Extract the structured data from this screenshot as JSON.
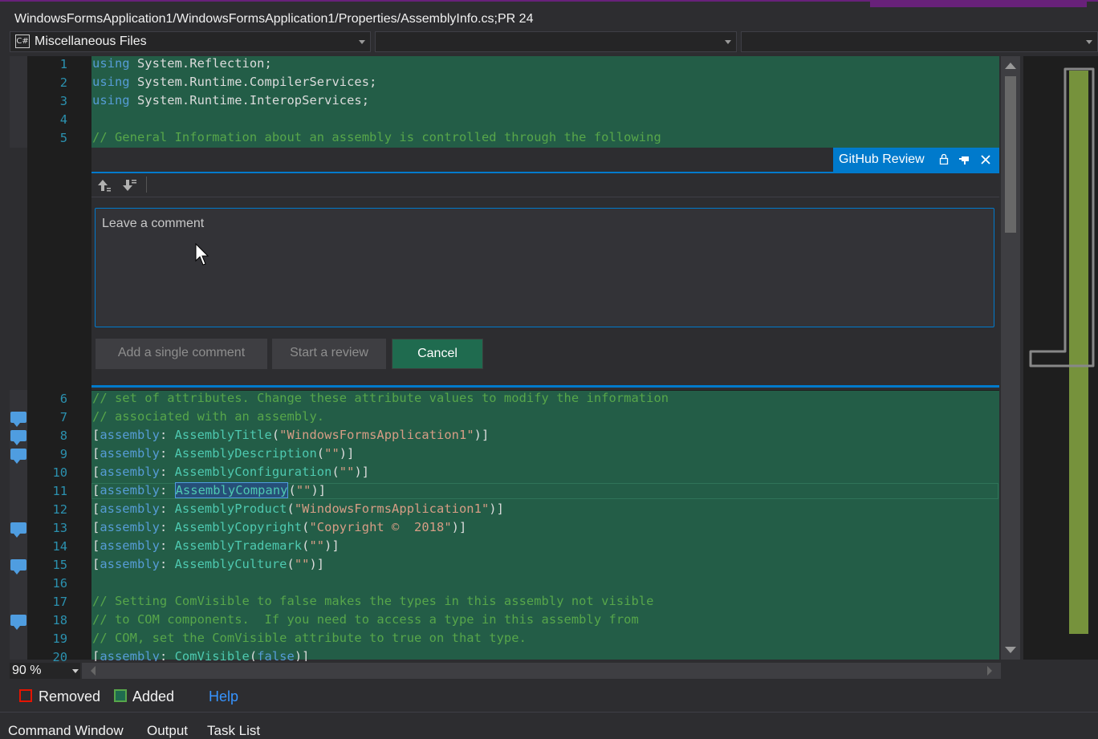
{
  "window": {
    "title": "WindowsFormsApplication1/WindowsFormsApplication1/Properties/AssemblyInfo.cs;PR 24",
    "accent_color": "#68217a"
  },
  "navbar": {
    "project_icon": "csharp-file-icon",
    "project_combo": "Miscellaneous Files",
    "type_combo": "",
    "member_combo": ""
  },
  "code_top": [
    {
      "n": "1",
      "tokens": [
        [
          "kw",
          "using"
        ],
        [
          "pl",
          " System.Reflection;"
        ]
      ]
    },
    {
      "n": "2",
      "tokens": [
        [
          "kw",
          "using"
        ],
        [
          "pl",
          " System.Runtime.CompilerServices;"
        ]
      ]
    },
    {
      "n": "3",
      "tokens": [
        [
          "kw",
          "using"
        ],
        [
          "pl",
          " System.Runtime.InteropServices;"
        ]
      ]
    },
    {
      "n": "4",
      "tokens": []
    },
    {
      "n": "5",
      "tokens": [
        [
          "cm",
          "// General Information about an assembly is controlled through the following"
        ]
      ]
    }
  ],
  "review": {
    "tab_label": "GitHub Review",
    "placeholder": "Leave a comment",
    "add_single": "Add a single comment",
    "start_review": "Start a review",
    "cancel": "Cancel",
    "highlight_color": "#007acc"
  },
  "code_bottom": [
    {
      "n": "6",
      "tokens": [
        [
          "cm",
          "// set of attributes. Change these attribute values to modify the information"
        ]
      ]
    },
    {
      "n": "7",
      "comment": true,
      "tokens": [
        [
          "cm",
          "// associated with an assembly."
        ]
      ]
    },
    {
      "n": "8",
      "comment": true,
      "tokens": [
        [
          "pl",
          "["
        ],
        [
          "kw",
          "assembly"
        ],
        [
          "pl",
          ": "
        ],
        [
          "ty",
          "AssemblyTitle"
        ],
        [
          "pl",
          "("
        ],
        [
          "st",
          "\"WindowsFormsApplication1\""
        ],
        [
          "pl",
          ")]"
        ]
      ]
    },
    {
      "n": "9",
      "comment": true,
      "tokens": [
        [
          "pl",
          "["
        ],
        [
          "kw",
          "assembly"
        ],
        [
          "pl",
          ": "
        ],
        [
          "ty",
          "AssemblyDescription"
        ],
        [
          "pl",
          "("
        ],
        [
          "st",
          "\"\""
        ],
        [
          "pl",
          ")]"
        ]
      ]
    },
    {
      "n": "10",
      "tokens": [
        [
          "pl",
          "["
        ],
        [
          "kw",
          "assembly"
        ],
        [
          "pl",
          ": "
        ],
        [
          "ty",
          "AssemblyConfiguration"
        ],
        [
          "pl",
          "("
        ],
        [
          "st",
          "\"\""
        ],
        [
          "pl",
          ")]"
        ]
      ]
    },
    {
      "n": "11",
      "current": true,
      "tokens": [
        [
          "pl",
          "["
        ],
        [
          "kw",
          "assembly"
        ],
        [
          "pl",
          ": "
        ],
        [
          "sel",
          "AssemblyCompany"
        ],
        [
          "pl",
          "("
        ],
        [
          "st",
          "\"\""
        ],
        [
          "pl",
          ")]"
        ]
      ]
    },
    {
      "n": "12",
      "tokens": [
        [
          "pl",
          "["
        ],
        [
          "kw",
          "assembly"
        ],
        [
          "pl",
          ": "
        ],
        [
          "ty",
          "AssemblyProduct"
        ],
        [
          "pl",
          "("
        ],
        [
          "st",
          "\"WindowsFormsApplication1\""
        ],
        [
          "pl",
          ")]"
        ]
      ]
    },
    {
      "n": "13",
      "comment": true,
      "tokens": [
        [
          "pl",
          "["
        ],
        [
          "kw",
          "assembly"
        ],
        [
          "pl",
          ": "
        ],
        [
          "ty",
          "AssemblyCopyright"
        ],
        [
          "pl",
          "("
        ],
        [
          "st",
          "\"Copyright ©  2018\""
        ],
        [
          "pl",
          ")]"
        ]
      ]
    },
    {
      "n": "14",
      "tokens": [
        [
          "pl",
          "["
        ],
        [
          "kw",
          "assembly"
        ],
        [
          "pl",
          ": "
        ],
        [
          "ty",
          "AssemblyTrademark"
        ],
        [
          "pl",
          "("
        ],
        [
          "st",
          "\"\""
        ],
        [
          "pl",
          ")]"
        ]
      ]
    },
    {
      "n": "15",
      "comment": true,
      "tokens": [
        [
          "pl",
          "["
        ],
        [
          "kw",
          "assembly"
        ],
        [
          "pl",
          ": "
        ],
        [
          "ty",
          "AssemblyCulture"
        ],
        [
          "pl",
          "("
        ],
        [
          "st",
          "\"\""
        ],
        [
          "pl",
          ")]"
        ]
      ]
    },
    {
      "n": "16",
      "tokens": []
    },
    {
      "n": "17",
      "tokens": [
        [
          "cm",
          "// Setting ComVisible to false makes the types in this assembly not visible"
        ]
      ]
    },
    {
      "n": "18",
      "comment": true,
      "tokens": [
        [
          "cm",
          "// to COM components.  If you need to access a type in this assembly from"
        ]
      ]
    },
    {
      "n": "19",
      "tokens": [
        [
          "cm",
          "// COM, set the ComVisible attribute to true on that type."
        ]
      ]
    },
    {
      "n": "20",
      "tokens": [
        [
          "pl",
          "["
        ],
        [
          "kw",
          "assembly"
        ],
        [
          "pl",
          ": "
        ],
        [
          "ty",
          "ComVisible"
        ],
        [
          "pl",
          "("
        ],
        [
          "kw",
          "false"
        ],
        [
          "pl",
          ")]"
        ]
      ]
    }
  ],
  "status": {
    "zoom": "90 %"
  },
  "legend": {
    "removed": "Removed",
    "added": "Added",
    "help": "Help",
    "removed_color": "#e51400",
    "added_color": "#1f6b4f"
  },
  "bottom_tabs": [
    "Command Window",
    "Output",
    "Task List"
  ],
  "minimap": {
    "bar_color": "#76923c"
  }
}
